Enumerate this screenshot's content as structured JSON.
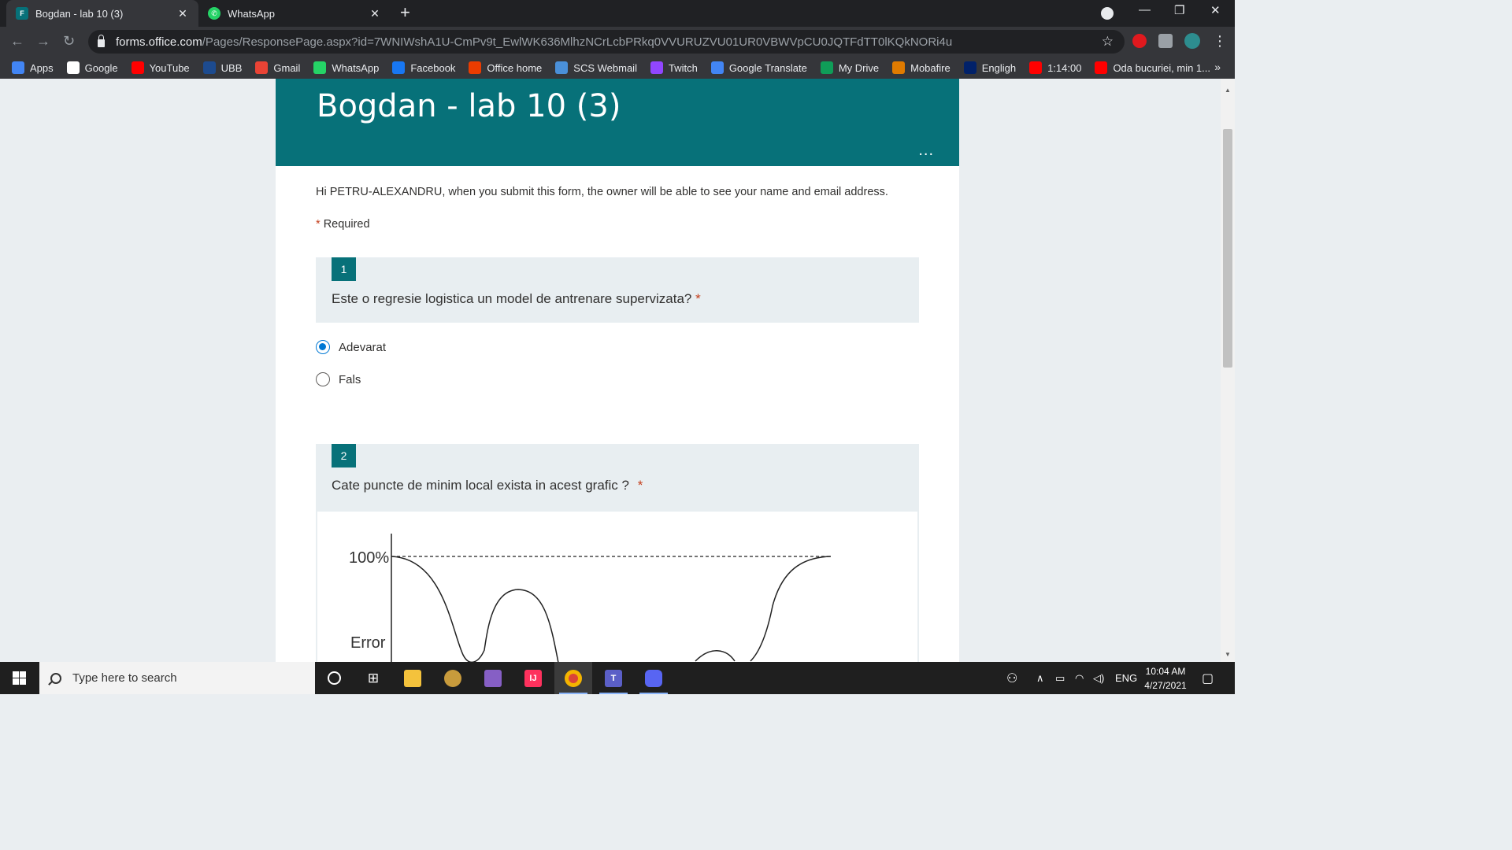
{
  "browser": {
    "tabs": [
      {
        "title": "Bogdan - lab 10 (3)",
        "active": true
      },
      {
        "title": "WhatsApp",
        "active": false
      }
    ],
    "new_tab": "+",
    "url_host": "forms.office.com",
    "url_path": "/Pages/ResponsePage.aspx?id=7WNIWshA1U-CmPv9t_EwlWK636MlhzNCrLcbPRkq0VVURUZVU01UR0VBWVpCU0JQTFdTT0lKQkNORi4u",
    "bookmarks": [
      {
        "label": "Apps",
        "icon": "apps-grid-icon",
        "color": "#4285f4"
      },
      {
        "label": "Google",
        "icon": "google-icon",
        "color": "#ffffff"
      },
      {
        "label": "YouTube",
        "icon": "youtube-icon",
        "color": "#ff0000"
      },
      {
        "label": "UBB",
        "icon": "ubb-icon",
        "color": "#1d4b8f"
      },
      {
        "label": "Gmail",
        "icon": "gmail-icon",
        "color": "#ea4335"
      },
      {
        "label": "WhatsApp",
        "icon": "whatsapp-icon",
        "color": "#25d366"
      },
      {
        "label": "Facebook",
        "icon": "facebook-icon",
        "color": "#1877f2"
      },
      {
        "label": "Office home",
        "icon": "office-icon",
        "color": "#eb3c00"
      },
      {
        "label": "SCS Webmail",
        "icon": "webmail-icon",
        "color": "#4a90d9"
      },
      {
        "label": "Twitch",
        "icon": "twitch-icon",
        "color": "#9146ff"
      },
      {
        "label": "Google Translate",
        "icon": "translate-icon",
        "color": "#4285f4"
      },
      {
        "label": "My Drive",
        "icon": "drive-icon",
        "color": "#0f9d58"
      },
      {
        "label": "Mobafire",
        "icon": "mobafire-icon",
        "color": "#e07b00"
      },
      {
        "label": "Engligh",
        "icon": "uk-flag-icon",
        "color": "#012169"
      },
      {
        "label": "1:14:00",
        "icon": "youtube-icon",
        "color": "#ff0000"
      },
      {
        "label": "Oda bucuriei, min 1...",
        "icon": "youtube-icon",
        "color": "#ff0000"
      }
    ],
    "bookmarks_more": "»"
  },
  "form": {
    "title": "Bogdan - lab 10 (3)",
    "more": "...",
    "notice": "Hi PETRU-ALEXANDRU, when you submit this form, the owner will be able to see your name and email address.",
    "required_star": "*",
    "required_label": "Required",
    "questions": [
      {
        "number": "1",
        "text": "Este o regresie logistica un model de antrenare supervizata?",
        "required": "*",
        "options": [
          {
            "label": "Adevarat",
            "selected": true
          },
          {
            "label": "Fals",
            "selected": false
          }
        ]
      },
      {
        "number": "2",
        "text": "Cate puncte de minim local exista in acest grafic ?",
        "required": "*",
        "image": {
          "label_top": "100%",
          "label_axis": "Error"
        }
      }
    ]
  },
  "taskbar": {
    "search_placeholder": "Type here to search",
    "language": "ENG",
    "time": "10:04 AM",
    "date": "4/27/2021"
  }
}
